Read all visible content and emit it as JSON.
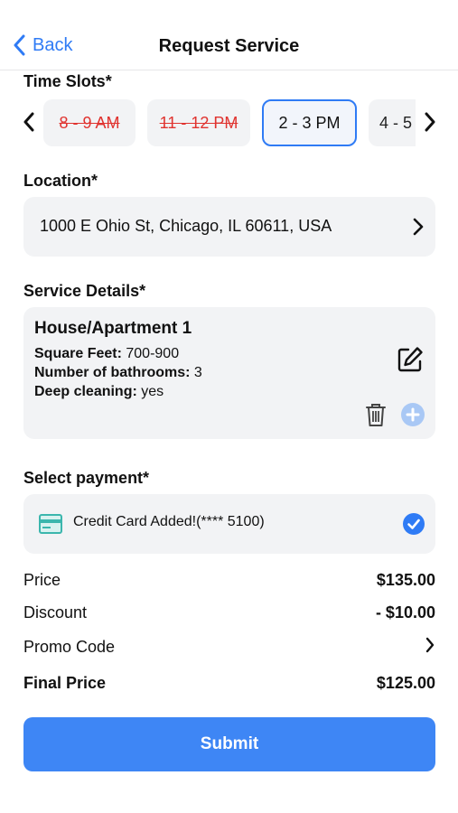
{
  "nav": {
    "back_label": "Back",
    "title": "Request Service"
  },
  "time_slots": {
    "title": "Time Slots*",
    "slots": [
      {
        "label": "8 - 9 AM",
        "state": "unavailable"
      },
      {
        "label": "11 - 12 PM",
        "state": "unavailable"
      },
      {
        "label": "2 - 3 PM",
        "state": "selected"
      },
      {
        "label": "4 - 5",
        "state": "available"
      }
    ]
  },
  "location": {
    "title": "Location*",
    "address": "1000 E Ohio St, Chicago, IL 60611, USA"
  },
  "service_details": {
    "title": "Service Details*",
    "item_title": "House/Apartment 1",
    "fields": [
      {
        "label": "Square Feet:",
        "value": "700-900"
      },
      {
        "label": "Number of bathrooms:",
        "value": "3"
      },
      {
        "label": "Deep cleaning:",
        "value": "yes"
      }
    ]
  },
  "payment": {
    "title": "Select payment*",
    "method_text": "Credit Card Added!(**** 5100)"
  },
  "pricing": {
    "price_label": "Price",
    "price_value": "$135.00",
    "discount_label": "Discount",
    "discount_value": "- $10.00",
    "promo_label": "Promo Code",
    "final_label": "Final Price",
    "final_value": "$125.00"
  },
  "submit_label": "Submit",
  "colors": {
    "accent": "#2f7bf5",
    "submit": "#3e86f5",
    "unavailable": "#e0332f",
    "card_bg": "#f2f3f5"
  },
  "icons": [
    "chevron-left-icon",
    "chevron-right-icon",
    "edit-icon",
    "trash-icon",
    "plus-circle-icon",
    "credit-card-icon",
    "check-circle-icon"
  ]
}
